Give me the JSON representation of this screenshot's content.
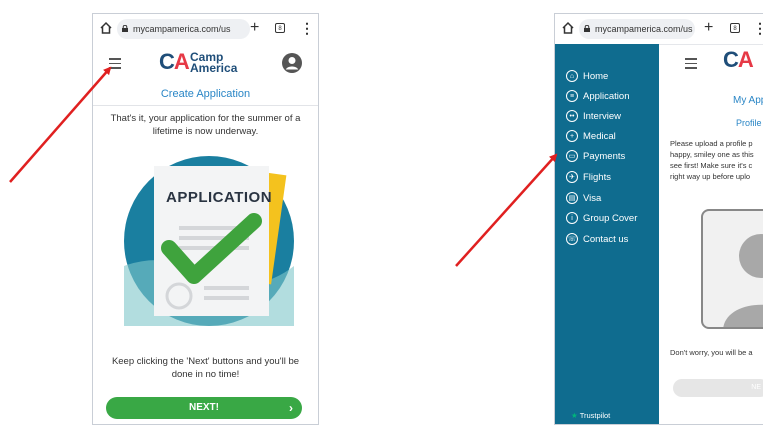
{
  "left_phone": {
    "url": "mycampamerica.com/us",
    "logo": {
      "mark": "CA",
      "line1": "Camp",
      "line2": "America"
    },
    "page_title": "Create Application",
    "intro_text_line1": "That's it, your application for the summer of a",
    "intro_text_line2": "lifetime is now underway.",
    "illustration_label": "APPLICATION",
    "hint_line1": "Keep clicking the 'Next' buttons and you'll be",
    "hint_line2": "done in no time!",
    "next_button": "NEXT!",
    "tabs_count": "8"
  },
  "right_phone": {
    "url": "mycampamerica.com/us",
    "logo_mark": "CA",
    "sidebar": {
      "items": [
        {
          "label": "Home",
          "icon": "home-icon"
        },
        {
          "label": "Application",
          "icon": "document-icon"
        },
        {
          "label": "Interview",
          "icon": "people-icon"
        },
        {
          "label": "Medical",
          "icon": "plus-icon"
        },
        {
          "label": "Payments",
          "icon": "card-icon"
        },
        {
          "label": "Flights",
          "icon": "plane-icon"
        },
        {
          "label": "Visa",
          "icon": "passport-icon"
        },
        {
          "label": "Group Cover",
          "icon": "info-icon"
        },
        {
          "label": "Contact us",
          "icon": "phone-icon"
        }
      ],
      "trustpilot": "Trustpilot"
    },
    "main_title": "My App",
    "sub_title": "Profile",
    "para_line1": "Please upload a profile p",
    "para_line2": "happy, smiley one as this",
    "para_line3": "see first! Make sure it's c",
    "para_line4": "right way up before uplo",
    "note": "Don't worry, you will be a",
    "next_button": "NE",
    "tabs_count": "8"
  },
  "colors": {
    "accent_blue": "#2a86c6",
    "sidebar_teal": "#0f6c8f",
    "next_green": "#39a845",
    "arrow_red": "#e02020"
  }
}
